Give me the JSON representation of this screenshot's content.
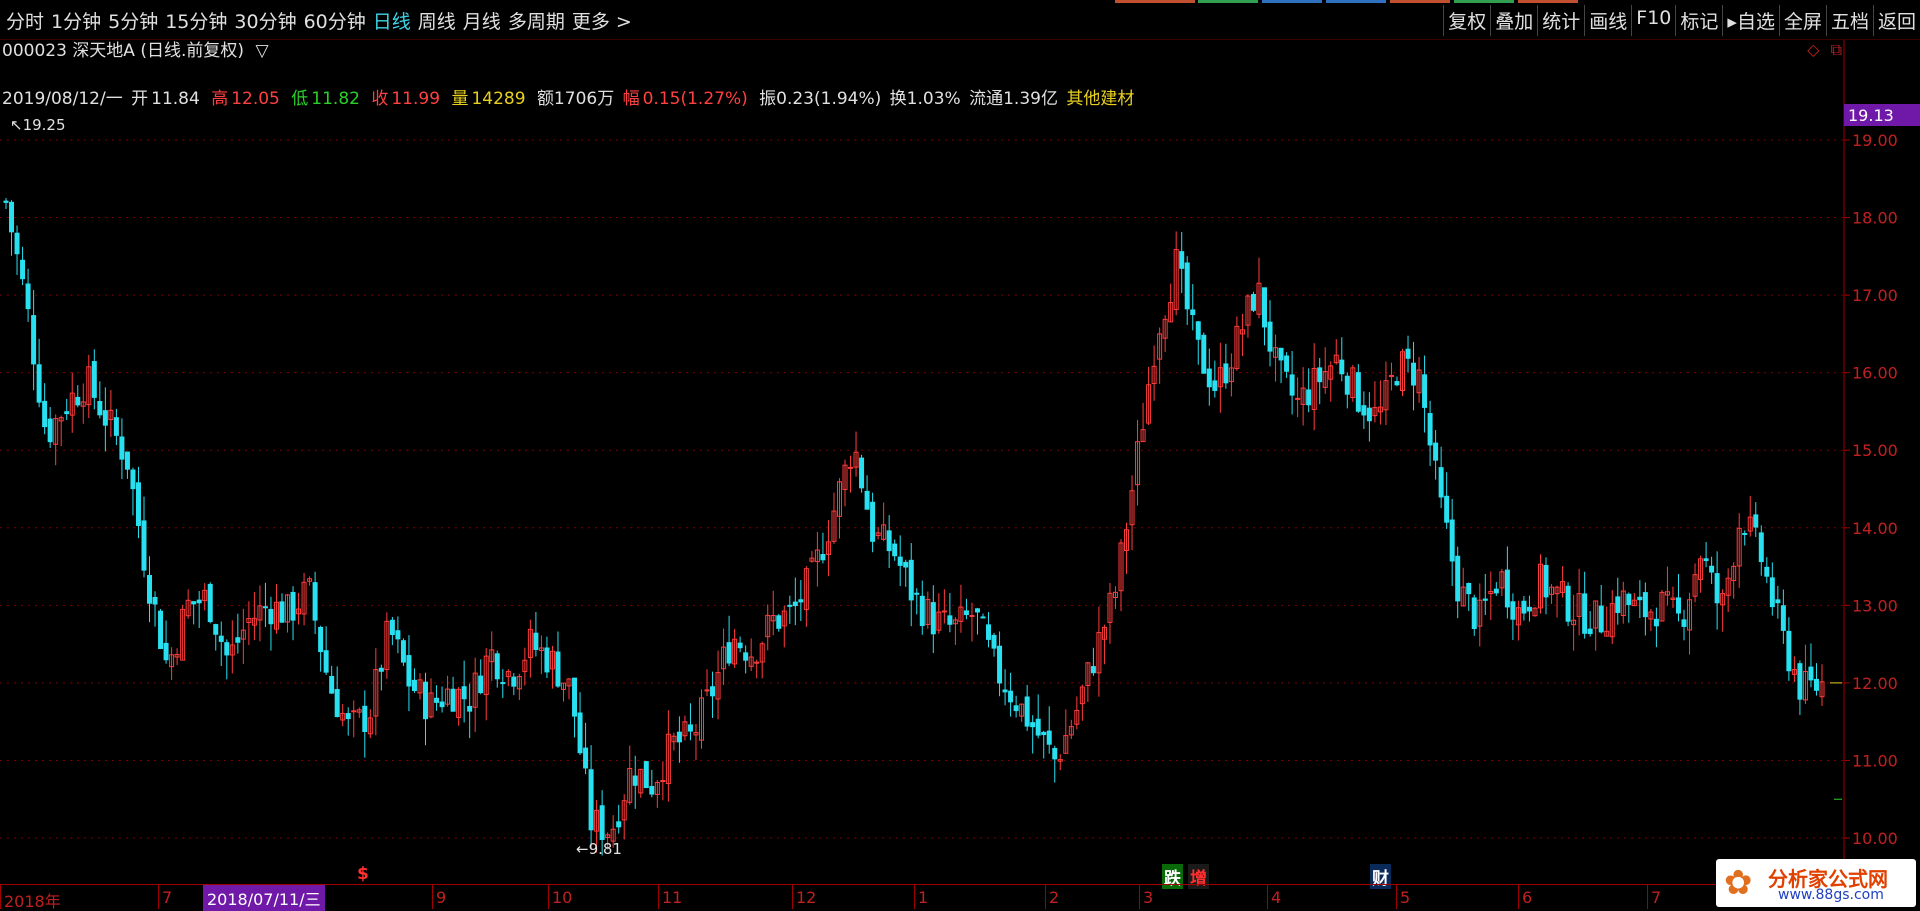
{
  "period_tabs": [
    {
      "label": "分时",
      "active": false
    },
    {
      "label": "1分钟",
      "active": false
    },
    {
      "label": "5分钟",
      "active": false
    },
    {
      "label": "15分钟",
      "active": false
    },
    {
      "label": "30分钟",
      "active": false
    },
    {
      "label": "60分钟",
      "active": false
    },
    {
      "label": "日线",
      "active": true
    },
    {
      "label": "周线",
      "active": false
    },
    {
      "label": "月线",
      "active": false
    },
    {
      "label": "多周期",
      "active": false
    },
    {
      "label": "更多 >",
      "active": false
    }
  ],
  "tool_buttons": [
    "复权",
    "叠加",
    "统计",
    "画线",
    "F10",
    "标记",
    "▸自选",
    "全屏",
    "五档",
    "返回"
  ],
  "title": {
    "code": "000023",
    "name": "深天地A",
    "mode": "(日线.前复权)",
    "toggle": "▽"
  },
  "info": {
    "date": "2019/08/12/一",
    "open_label": "开",
    "open": "11.84",
    "high_label": "高",
    "high": "12.05",
    "low_label": "低",
    "low": "11.82",
    "close_label": "收",
    "close": "11.99",
    "vol_label": "量",
    "vol": "14289",
    "amount": "额1706万",
    "change_label": "幅",
    "change": "0.15(1.27%)",
    "amplitude": "振0.23(1.94%)",
    "turnover": "换1.03%",
    "float_cap": "流通1.39亿",
    "sector": "其他建材"
  },
  "price_axis": {
    "labels": [
      "19.00",
      "18.00",
      "17.00",
      "16.00",
      "15.00",
      "14.00",
      "13.00",
      "12.00",
      "11.00",
      "10.00"
    ],
    "cursor_price": "19.13"
  },
  "date_axis": {
    "labels": [
      "2018年",
      "7",
      "9",
      "10",
      "11",
      "12",
      "1",
      "2",
      "3",
      "4",
      "5",
      "6",
      "7"
    ],
    "cursor_date": "2018/07/11/三"
  },
  "markers": {
    "high_label": "19.25",
    "low_label": "9.81"
  },
  "events": {
    "dollar": "$",
    "die": "跌",
    "zeng": "增",
    "cai": "财"
  },
  "watermark": {
    "title": "分析家公式网",
    "url": "www.88gs.com"
  },
  "colors": {
    "up": "#ff3c3c",
    "down": "#28e0f0",
    "grid": "#7a0000",
    "cursor": "#7018a8"
  },
  "chart_data": {
    "type": "candlestick",
    "title": "000023 深天地A (日线.前复权)",
    "ylim": [
      9.81,
      19.25
    ],
    "y_ticks": [
      10,
      11,
      12,
      13,
      14,
      15,
      16,
      17,
      18,
      19
    ],
    "x_tick_labels": [
      "2018年",
      "7",
      "9",
      "10",
      "11",
      "12",
      "1",
      "2",
      "3",
      "4",
      "5",
      "6",
      "7"
    ],
    "x_range": [
      "2018",
      "2019-08-12"
    ],
    "annotations": [
      {
        "type": "max",
        "value": 19.25
      },
      {
        "type": "min",
        "value": 9.81
      }
    ],
    "close_path_approx": [
      18.2,
      16.9,
      15.2,
      15.6,
      15.9,
      15.4,
      14.9,
      13.4,
      12.2,
      13.0,
      13.1,
      12.3,
      12.8,
      13.0,
      12.9,
      13.2,
      12.0,
      11.4,
      11.6,
      12.7,
      12.0,
      11.7,
      11.9,
      11.8,
      12.4,
      12.1,
      12.5,
      12.3,
      11.9,
      10.2,
      10.1,
      10.9,
      10.7,
      11.2,
      11.3,
      11.9,
      12.6,
      12.4,
      12.8,
      12.9,
      13.4,
      14.2,
      15.1,
      13.9,
      13.7,
      13.1,
      12.8,
      12.7,
      12.9,
      12.2,
      11.8,
      11.4,
      11.0,
      11.6,
      12.4,
      13.2,
      14.8,
      16.5,
      17.4,
      16.3,
      15.8,
      16.4,
      17.1,
      16.0,
      15.6,
      15.9,
      16.2,
      15.7,
      15.4,
      16.1,
      16.0,
      14.4,
      13.2,
      12.8,
      13.4,
      12.9,
      13.3,
      13.1,
      12.9,
      12.8,
      13.1,
      12.9,
      13.0,
      12.8,
      13.7,
      12.9,
      14.2,
      13.6,
      12.6,
      11.9,
      11.99
    ]
  }
}
